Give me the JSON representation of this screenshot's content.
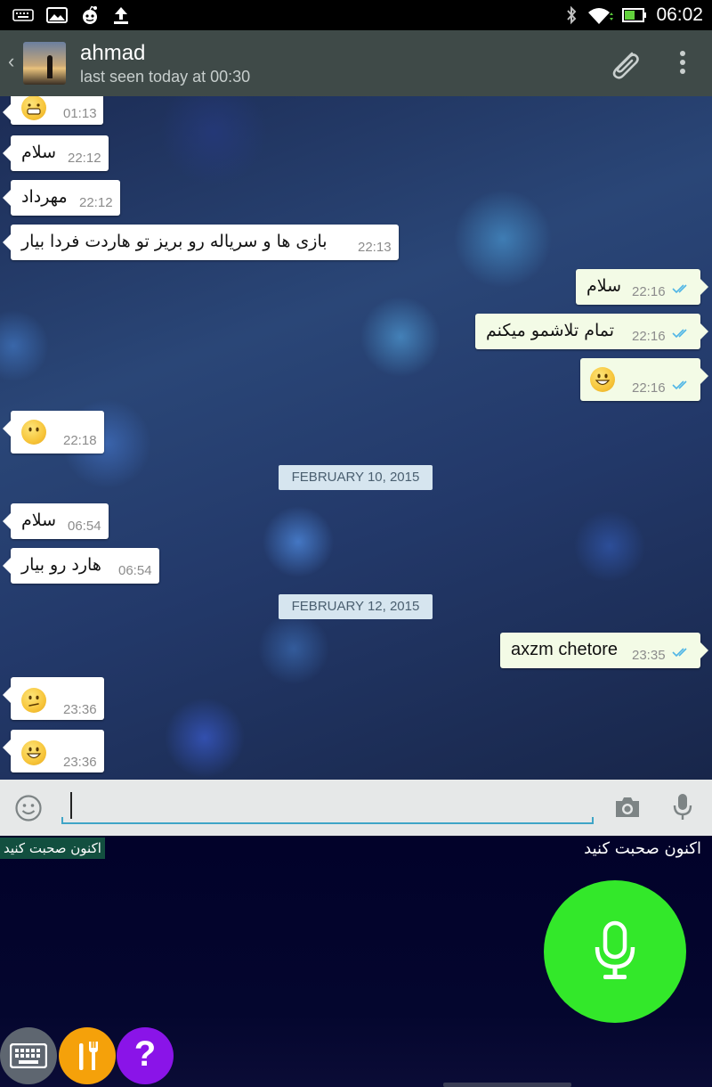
{
  "status_bar": {
    "time": "06:02",
    "icons": [
      "keyboard-icon",
      "image-icon",
      "reddit-icon",
      "upload-icon",
      "bluetooth-icon",
      "wifi-icon",
      "battery-icon"
    ]
  },
  "header": {
    "back_icon": "‹",
    "contact_name": "ahmad",
    "last_seen": "last seen today at 00:30"
  },
  "messages": [
    {
      "dir": "in",
      "emoji": "grin",
      "time": "01:13"
    },
    {
      "dir": "in",
      "text": "سلام",
      "time": "22:12"
    },
    {
      "dir": "in",
      "text": "مهرداد",
      "time": "22:12"
    },
    {
      "dir": "in",
      "text": "بازی ها و سریاله رو بریز تو هاردت فردا بیار",
      "time": "22:13"
    },
    {
      "dir": "out",
      "text": "سلام",
      "time": "22:16"
    },
    {
      "dir": "out",
      "text": "تمام تلاشمو میکنم",
      "time": "22:16"
    },
    {
      "dir": "out",
      "emoji": "smile",
      "time": "22:16"
    },
    {
      "dir": "in",
      "emoji": "neutral",
      "time": "22:18"
    },
    {
      "date": "FEBRUARY 10, 2015"
    },
    {
      "dir": "in",
      "text": "سلام",
      "time": "06:54"
    },
    {
      "dir": "in",
      "text": "هارد رو بیار",
      "time": "06:54"
    },
    {
      "date": "FEBRUARY 12, 2015"
    },
    {
      "dir": "out",
      "text": "axzm chetore",
      "time": "23:35"
    },
    {
      "dir": "in",
      "emoji": "confused",
      "time": "23:36"
    },
    {
      "dir": "in",
      "emoji": "smile",
      "time": "23:36"
    }
  ],
  "input": {
    "value": "",
    "icons": [
      "emoji-icon",
      "camera-icon",
      "microphone-icon"
    ]
  },
  "voice_keyboard": {
    "label_left": "اکنون صحبت کنید",
    "label_right": "اکنون صحبت کنید",
    "mic_color": "#33e82a",
    "buttons": [
      "keyboard-icon",
      "tools-icon",
      "help-icon"
    ],
    "help_label": "?"
  },
  "colors": {
    "header": "#3f4a48",
    "incoming_bubble": "#ffffff",
    "outgoing_bubble": "#f3fbe6",
    "date_badge": "#d6e5ef",
    "read_ticks": "#4fb5e6",
    "tools_button": "#f5a10a",
    "help_button": "#8a14e8",
    "keyboard_button": "#5e6670"
  }
}
